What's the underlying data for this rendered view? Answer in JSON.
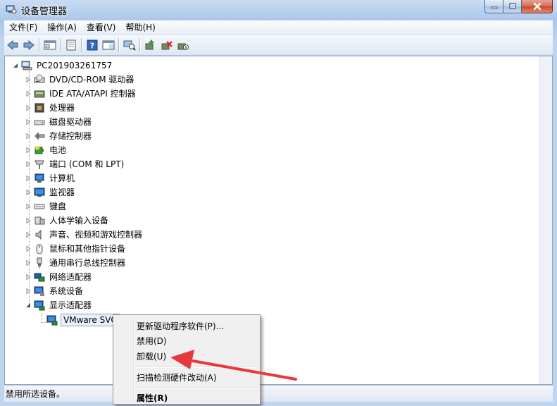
{
  "window": {
    "title": "设备管理器"
  },
  "menubar": {
    "items": [
      "文件(F)",
      "操作(A)",
      "查看(V)",
      "帮助(H)"
    ]
  },
  "tree": {
    "root": "PC201903261757",
    "categories": [
      "DVD/CD-ROM 驱动器",
      "IDE ATA/ATAPI 控制器",
      "处理器",
      "磁盘驱动器",
      "存储控制器",
      "电池",
      "端口 (COM 和 LPT)",
      "计算机",
      "监视器",
      "键盘",
      "人体学输入设备",
      "声音、视频和游戏控制器",
      "鼠标和其他指针设备",
      "通用串行总线控制器",
      "网络适配器",
      "系统设备",
      "显示适配器"
    ],
    "selected_child": "VMware SVG"
  },
  "context_menu": {
    "update_driver": "更新驱动程序软件(P)...",
    "disable": "禁用(D)",
    "uninstall": "卸载(U)",
    "scan": "扫描检测硬件改动(A)",
    "properties": "属性(R)"
  },
  "statusbar": {
    "text": "禁用所选设备。"
  },
  "colors": {
    "annotation_arrow": "#e8383d",
    "close_button": "#c44a2f"
  }
}
